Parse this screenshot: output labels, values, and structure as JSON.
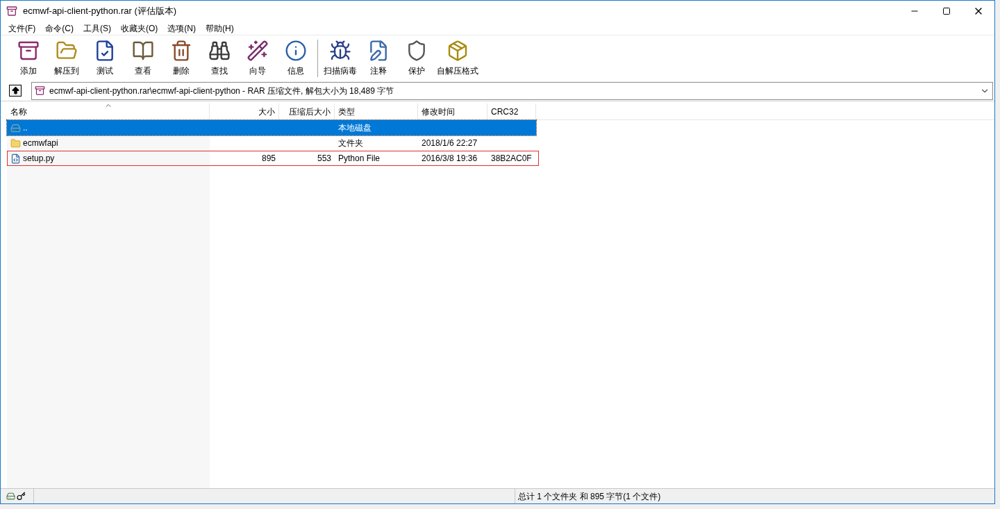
{
  "window": {
    "title": "ecmwf-api-client-python.rar (评估版本)"
  },
  "menu": [
    "文件(F)",
    "命令(C)",
    "工具(S)",
    "收藏夹(O)",
    "选项(N)",
    "帮助(H)"
  ],
  "toolbar_groups": [
    [
      {
        "label": "添加",
        "kind": "archive"
      },
      {
        "label": "解压到",
        "kind": "folder"
      },
      {
        "label": "测试",
        "kind": "check"
      },
      {
        "label": "查看",
        "kind": "book"
      },
      {
        "label": "删除",
        "kind": "trash"
      },
      {
        "label": "查找",
        "kind": "binoculars"
      },
      {
        "label": "向导",
        "kind": "wand"
      },
      {
        "label": "信息",
        "kind": "info"
      }
    ],
    [
      {
        "label": "扫描病毒",
        "kind": "bug"
      },
      {
        "label": "注释",
        "kind": "pen"
      },
      {
        "label": "保护",
        "kind": "shield"
      },
      {
        "label": "自解压格式",
        "kind": "package"
      }
    ]
  ],
  "address": {
    "value": "ecmwf-api-client-python.rar\\ecmwf-api-client-python - RAR 压缩文件, 解包大小为 18,489 字节"
  },
  "table": {
    "columns": [
      {
        "label": "名称",
        "sorted": true
      },
      {
        "label": "大小",
        "sorted": false
      },
      {
        "label": "压缩后大小",
        "sorted": false
      },
      {
        "label": "类型",
        "sorted": false
      },
      {
        "label": "修改时间",
        "sorted": false
      },
      {
        "label": "CRC32",
        "sorted": false
      }
    ],
    "rows": [
      {
        "kind": "parent",
        "selected": true,
        "outlined": false,
        "cells": [
          "..",
          "",
          "",
          "本地磁盘",
          "",
          ""
        ]
      },
      {
        "kind": "folder",
        "selected": false,
        "outlined": false,
        "cells": [
          "ecmwfapi",
          "",
          "",
          "文件夹",
          "2018/1/6 22:27",
          ""
        ]
      },
      {
        "kind": "file",
        "selected": false,
        "outlined": true,
        "cells": [
          "setup.py",
          "895",
          "553",
          "Python File",
          "2016/3/8 19:36",
          "38B2AC0F"
        ]
      }
    ]
  },
  "status_bar": {
    "text": "总计 1 个文件夹 和 895 字节(1 个文件)"
  }
}
